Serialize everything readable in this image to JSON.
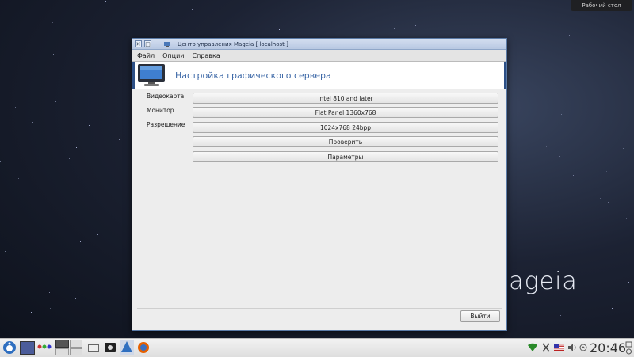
{
  "desktop": {
    "top_label": "Рабочий стол",
    "logo_text": "ageia"
  },
  "window": {
    "title": "Центр управления Mageia  [ localhost ]",
    "menu": [
      {
        "label": "Файл"
      },
      {
        "label": "Опции"
      },
      {
        "label": "Справка"
      }
    ],
    "banner_title": "Настройка графического сервера",
    "rows": [
      {
        "label": "Видеокарта",
        "value": "Intel 810 and later"
      },
      {
        "label": "Монитор",
        "value": "Flat Panel 1360x768"
      },
      {
        "label": "Разрешение",
        "value": "1024x768 24bpp"
      }
    ],
    "actions": [
      {
        "label": "Проверить"
      },
      {
        "label": "Параметры"
      }
    ],
    "exit_label": "Выйти"
  },
  "taskbar": {
    "clock": "20:46",
    "colors": {
      "accent": "#2c4f86",
      "banner_title": "#3f6aa8"
    }
  }
}
